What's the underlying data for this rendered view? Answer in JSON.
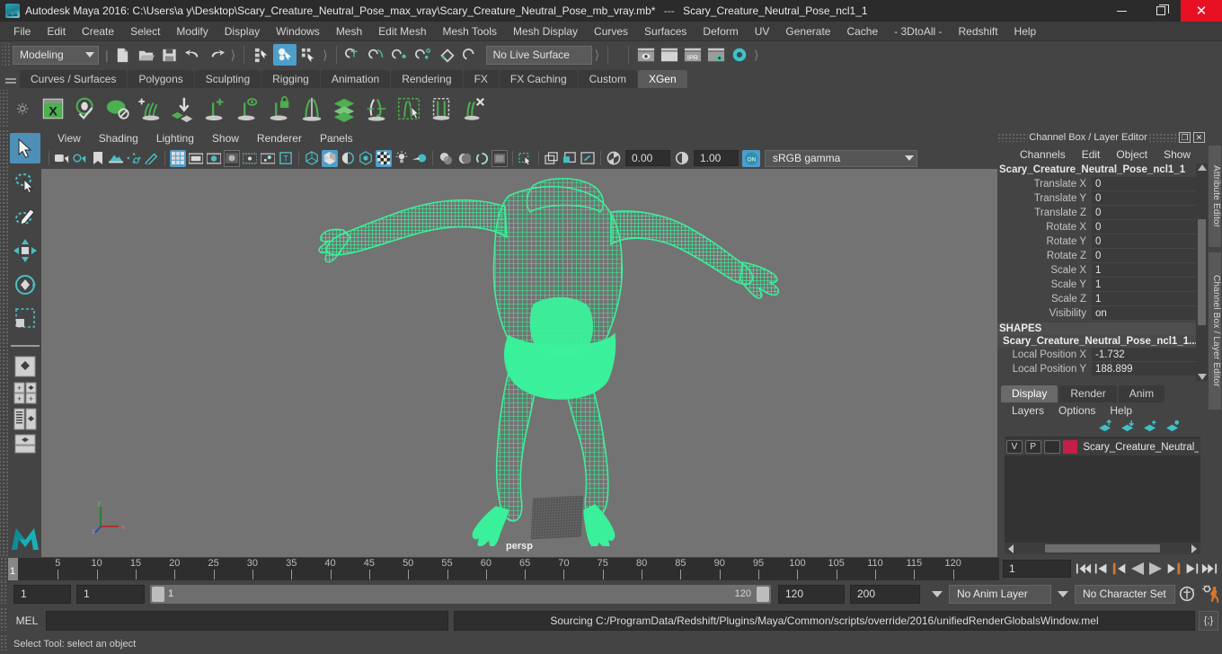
{
  "titlebar": {
    "app_title": "Autodesk Maya 2016: C:\\Users\\a y\\Desktop\\Scary_Creature_Neutral_Pose_max_vray\\Scary_Creature_Neutral_Pose_mb_vray.mb*",
    "separator": "---",
    "selection_title": "Scary_Creature_Neutral_Pose_ncl1_1",
    "minimize": "–",
    "maximize": "❐",
    "close": "✕",
    "close_color": "#e81123"
  },
  "menubar": {
    "items": [
      "File",
      "Edit",
      "Create",
      "Select",
      "Modify",
      "Display",
      "Windows",
      "Mesh",
      "Edit Mesh",
      "Mesh Tools",
      "Mesh Display",
      "Curves",
      "Surfaces",
      "Deform",
      "UV",
      "Generate",
      "Cache",
      "- 3DtoAll -",
      "Redshift",
      "Help"
    ]
  },
  "statusline": {
    "menu_set": "Modeling",
    "live_surface": "No Live Surface",
    "selection_mask_active_index": 1,
    "icons": [
      "new-scene-icon",
      "open-scene-icon",
      "save-scene-icon",
      "undo-icon",
      "redo-icon",
      "select-by-hierarchy-icon",
      "select-by-object-icon",
      "select-by-component-icon",
      "snap-to-grid-icon",
      "snap-to-curve-icon",
      "snap-to-point-icon",
      "snap-to-projected-center-icon",
      "snap-to-view-plane-icon",
      "make-live-icon",
      "render-view-icon",
      "render-current-frame-icon",
      "ipr-render-icon",
      "render-settings-icon",
      "hypershade-icon"
    ]
  },
  "shelf": {
    "tabs": [
      "Curves / Surfaces",
      "Polygons",
      "Sculpting",
      "Rigging",
      "Animation",
      "Rendering",
      "FX",
      "FX Caching",
      "Custom",
      "XGen"
    ],
    "active_tab": "XGen",
    "icon_names": [
      "xgen-window-icon",
      "xgen-preview-icon",
      "xgen-sphere-icon",
      "xgen-add-groom-icon",
      "xgen-place-icon",
      "xgen-add-guide-icon",
      "xgen-guide-visibility-icon",
      "xgen-lock-guide-icon",
      "xgen-mirror-guide-icon",
      "xgen-density-icon",
      "xgen-length-icon",
      "xgen-select-region-icon",
      "xgen-clump-icon",
      "xgen-delete-guide-icon"
    ],
    "accent_color": "#4caf50"
  },
  "toolbox": {
    "tools": [
      {
        "name": "select-tool",
        "active": true
      },
      {
        "name": "lasso-select-tool",
        "active": false
      },
      {
        "name": "paint-select-tool",
        "active": false
      },
      {
        "name": "move-tool",
        "active": false
      },
      {
        "name": "rotate-tool",
        "active": false
      },
      {
        "name": "scale-tool",
        "active": false
      }
    ],
    "layout_presets": [
      "single-perspective-layout",
      "four-view-layout",
      "outliner-persp-layout",
      "persp-graph-layout"
    ],
    "logo": "maya-logo"
  },
  "viewport": {
    "menus": [
      "View",
      "Shading",
      "Lighting",
      "Show",
      "Renderer",
      "Panels"
    ],
    "camera_label": "persp",
    "exposure": "0.00",
    "gamma": "1.00",
    "color_management": "sRGB gamma",
    "cm_toggle": "ON",
    "background_color": "#737373",
    "wireframe_color": "#3bf09a",
    "axis_labels": {
      "x": "x",
      "y": "y",
      "z": "z"
    },
    "toolbar_icons": [
      "select-camera-icon",
      "camera-attributes-icon",
      "bookmark-icon",
      "image-plane-icon",
      "2d-pan-zoom-icon",
      "grease-pencil-icon",
      "grid-toggle-icon",
      "film-gate-icon",
      "resolution-gate-icon",
      "gate-mask-icon",
      "film-origin-icon",
      "exposure-icon",
      "xray-icon",
      "wireframe-shading-icon",
      "smooth-shade-all-icon",
      "smooth-shade-selected-icon",
      "flat-shade-icon",
      "hardware-texturing-icon",
      "lighting-icon",
      "default-light-icon",
      "shadows-icon",
      "screen-space-ao-icon",
      "motion-blur-icon",
      "multisample-aa-icon",
      "isolate-select-icon",
      "xray-joints-icon",
      "render-region-icon",
      "panel-zoom-icon"
    ]
  },
  "channelbox": {
    "panel_title": "Channel Box / Layer Editor",
    "menus": [
      "Channels",
      "Edit",
      "Object",
      "Show"
    ],
    "object_name": "Scary_Creature_Neutral_Pose_ncl1_1",
    "transform_rows": [
      {
        "label": "Translate X",
        "value": "0"
      },
      {
        "label": "Translate Y",
        "value": "0"
      },
      {
        "label": "Translate Z",
        "value": "0"
      },
      {
        "label": "Rotate X",
        "value": "0"
      },
      {
        "label": "Rotate Y",
        "value": "0"
      },
      {
        "label": "Rotate Z",
        "value": "0"
      },
      {
        "label": "Scale X",
        "value": "1"
      },
      {
        "label": "Scale Y",
        "value": "1"
      },
      {
        "label": "Scale Z",
        "value": "1"
      },
      {
        "label": "Visibility",
        "value": "on"
      }
    ],
    "shapes_header": "SHAPES",
    "shape_name": "Scary_Creature_Neutral_Pose_ncl1_1...",
    "shape_rows": [
      {
        "label": "Local Position X",
        "value": "-1.732"
      },
      {
        "label": "Local Position Y",
        "value": "188.899"
      }
    ],
    "dock_buttons": [
      "undock-icon",
      "close-icon"
    ]
  },
  "layereditor": {
    "tabs": [
      "Display",
      "Render",
      "Anim"
    ],
    "active_tab": "Display",
    "menus": [
      "Layers",
      "Options",
      "Help"
    ],
    "toolbar_icons": [
      "move-layer-up-icon",
      "move-layer-down-icon",
      "new-layer-icon",
      "new-layer-from-selected-icon"
    ],
    "layers": [
      {
        "visibility": "V",
        "playback": "P",
        "shading": "",
        "color": "#c41e4a",
        "name": "Scary_Creature_Neutral_P"
      }
    ]
  },
  "sidetabs": [
    "Attribute Editor",
    "Channel Box / Layer Editor"
  ],
  "timeline": {
    "ticks": [
      5,
      10,
      15,
      20,
      25,
      30,
      35,
      40,
      45,
      50,
      55,
      60,
      65,
      70,
      75,
      80,
      85,
      90,
      95,
      100,
      105,
      110,
      115,
      120
    ],
    "current_frame": "1",
    "current_frame_field": "1",
    "playback_buttons": [
      "go-to-start-icon",
      "step-back-keyframe-icon",
      "step-back-frame-icon",
      "play-backwards-icon",
      "play-forwards-icon",
      "step-forward-frame-icon",
      "step-forward-keyframe-icon",
      "go-to-end-icon"
    ],
    "accent_color": "#d8762a"
  },
  "rangeslider": {
    "anim_start": "1",
    "range_start": "1",
    "slider_low": "1",
    "slider_high": "120",
    "range_end": "120",
    "anim_end": "200",
    "anim_layer": "No Anim Layer",
    "character_set": "No Character Set",
    "icons": [
      "auto-keyframe-icon",
      "animation-preferences-icon"
    ]
  },
  "commandline": {
    "label": "MEL",
    "input_value": "",
    "output_text": "Sourcing C:/ProgramData/Redshift/Plugins/Maya/Common/scripts/override/2016/unifiedRenderGlobalsWindow.mel",
    "script-editor-button": "{;}"
  },
  "helpline": {
    "text": "Select Tool: select an object"
  }
}
